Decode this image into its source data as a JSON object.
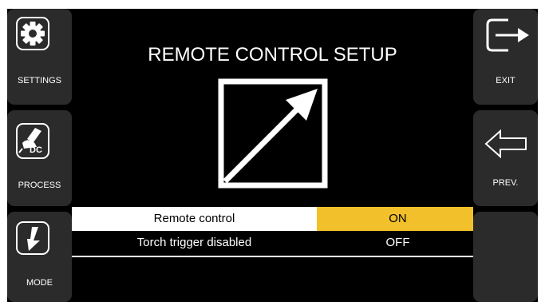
{
  "left_menu": {
    "settings_label": "SETTINGS",
    "process_label": "PROCESS",
    "process_badge": "DC",
    "mode_label": "MODE"
  },
  "right_menu": {
    "exit_label": "EXIT",
    "prev_label": "PREV."
  },
  "main": {
    "title": "REMOTE CONTROL SETUP",
    "rows": [
      {
        "name": "Remote control",
        "value": "ON",
        "selected": true
      },
      {
        "name": "Torch trigger disabled",
        "value": "OFF",
        "selected": false
      }
    ]
  },
  "colors": {
    "selected_value_bg": "#f2c02a",
    "button_bg": "#2b2b2b",
    "screen_bg": "#000000"
  },
  "icons": [
    "gear-icon",
    "torch-icon",
    "trigger-icon",
    "exit-arrow-icon",
    "back-arrow-icon",
    "remote-arrow-icon"
  ]
}
